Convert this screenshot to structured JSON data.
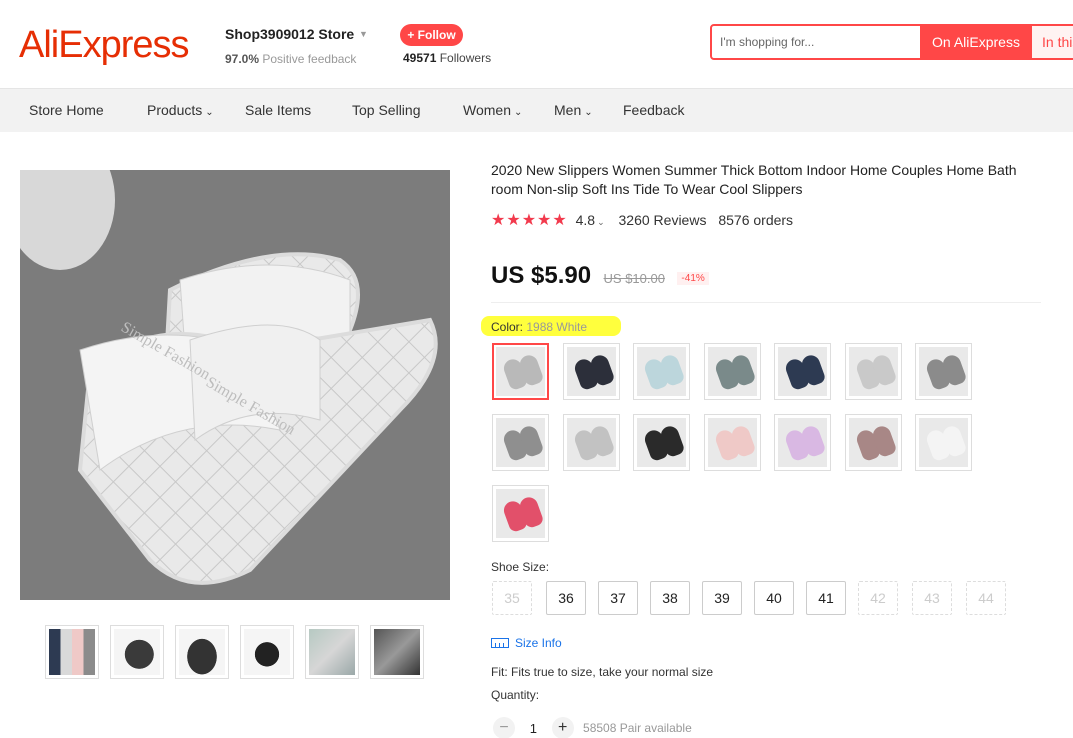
{
  "header": {
    "logo": "AliExpress",
    "store_name": "Shop3909012 Store",
    "feedback_pct": "97.0%",
    "feedback_text": "Positive feedback",
    "follow_label": "+ Follow",
    "followers_count": "49571",
    "followers_text": "Followers",
    "search_placeholder": "I'm shopping for...",
    "search_btn_primary": "On AliExpress",
    "search_btn_secondary": "In this store"
  },
  "nav": {
    "items": [
      "Store Home",
      "Products",
      "Sale Items",
      "Top Selling",
      "Women",
      "Men",
      "Feedback"
    ]
  },
  "product": {
    "title": "2020 New Slippers Women Summer Thick Bottom Indoor Home Couples Home Bath room Non-slip Soft Ins Tide To Wear Cool Slippers",
    "stars": "★★★★★",
    "rating": "4.8",
    "reviews": "3260 Reviews",
    "orders": "8576 orders",
    "price": "US $5.90",
    "original_price": "US $10.00",
    "discount": "-41%",
    "color_label": "Color:",
    "color_value": "1988 White",
    "swatch_colors": [
      "#b9b9b9",
      "#2c2f3a",
      "#bcd6dc",
      "#7a8a8a",
      "#2d3a52",
      "#c9c9c9",
      "#8b8b8b",
      "#8f8f8f",
      "#c2c2c2",
      "#2a2a2a",
      "#efc9c7",
      "#d9b8e3",
      "#a88786",
      "#f4f4f4",
      "#e2506a"
    ],
    "size_label": "Shoe Size:",
    "sizes": [
      {
        "label": "35",
        "available": false
      },
      {
        "label": "36",
        "available": true
      },
      {
        "label": "37",
        "available": true
      },
      {
        "label": "38",
        "available": true
      },
      {
        "label": "39",
        "available": true
      },
      {
        "label": "40",
        "available": true
      },
      {
        "label": "41",
        "available": true
      },
      {
        "label": "42",
        "available": false
      },
      {
        "label": "43",
        "available": false
      },
      {
        "label": "44",
        "available": false
      }
    ],
    "size_info": "Size Info",
    "fit": "Fit: Fits true to size, take your normal size",
    "quantity_label": "Quantity:",
    "quantity": "1",
    "available": "58508 Pair available"
  },
  "image_text": "Simple Fashion"
}
